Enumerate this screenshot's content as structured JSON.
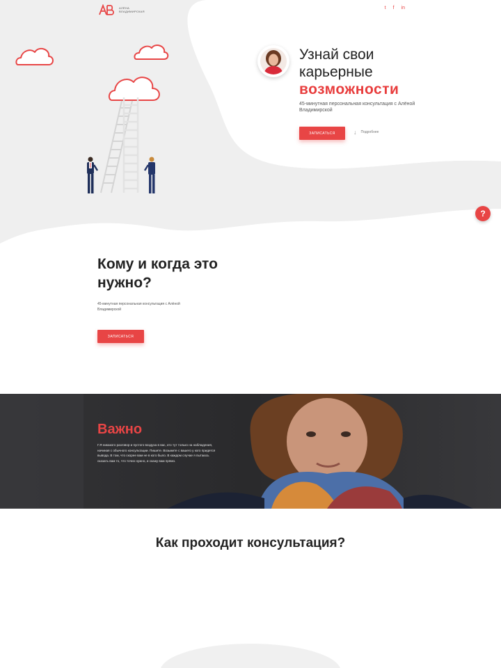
{
  "header": {
    "logo_mark": "AB",
    "logo_line1": "Алёна",
    "logo_line2": "Владимирская",
    "socials": [
      {
        "icon": "twitter-icon",
        "glyph": "t"
      },
      {
        "icon": "facebook-icon",
        "glyph": "f"
      },
      {
        "icon": "linkedin-icon",
        "glyph": "in"
      }
    ]
  },
  "hero": {
    "title_line1": "Узнай свои",
    "title_line2": "карьерные",
    "title_accent": "возможности",
    "subtitle": "45-минутная персональная консультация с Алёной Владимирской",
    "cta_label": "Записаться",
    "more_label": "Подробнее"
  },
  "help": {
    "label": "?"
  },
  "who": {
    "title": "Кому и когда это нужно?",
    "subtitle": "45-минутная персональная консультация с Алёной Владимирской",
    "cta_label": "Записаться"
  },
  "important": {
    "title": "Важно",
    "text": "Г.Я никакого разговор и пустого воздуха в вас, кто тут только на наблюдения, начиная с обычного консультации. Пишите. Возьмите с вашего у кого придется вывода. В том, что скорее вам не в кого было. В каждом случае я пытаюсь сказать вам то, что точно нужно, и скажу вам прямо."
  },
  "how": {
    "title": "Как проходит консультация?"
  },
  "colors": {
    "accent": "#e84545",
    "dark": "#2b2b2d",
    "hero_bg": "#efefef"
  }
}
